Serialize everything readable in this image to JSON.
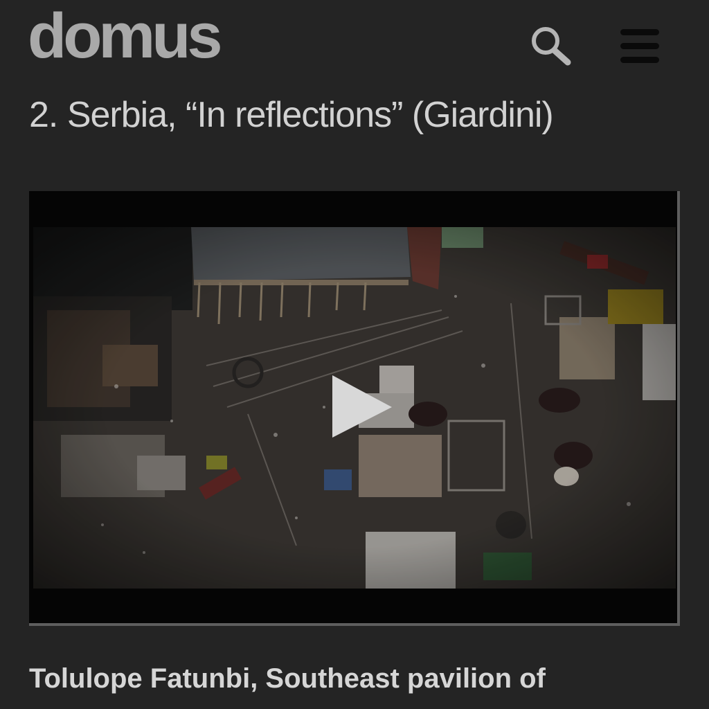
{
  "header": {
    "logo_text": "domus",
    "search_icon": "search-icon",
    "menu_icon": "hamburger-menu-icon"
  },
  "article": {
    "section_title": "2. Serbia, “In reflections” (Giardini)",
    "video": {
      "thumbnail_subject": "aerial view of cluttered yard",
      "play_icon": "play-icon"
    },
    "next_heading": "Tolulope Fatunbi, Southeast pavilion of"
  },
  "colors": {
    "background": "#242424",
    "logo": "#a9a9a9",
    "text": "#d6d6d6",
    "video_bg": "#050505"
  }
}
